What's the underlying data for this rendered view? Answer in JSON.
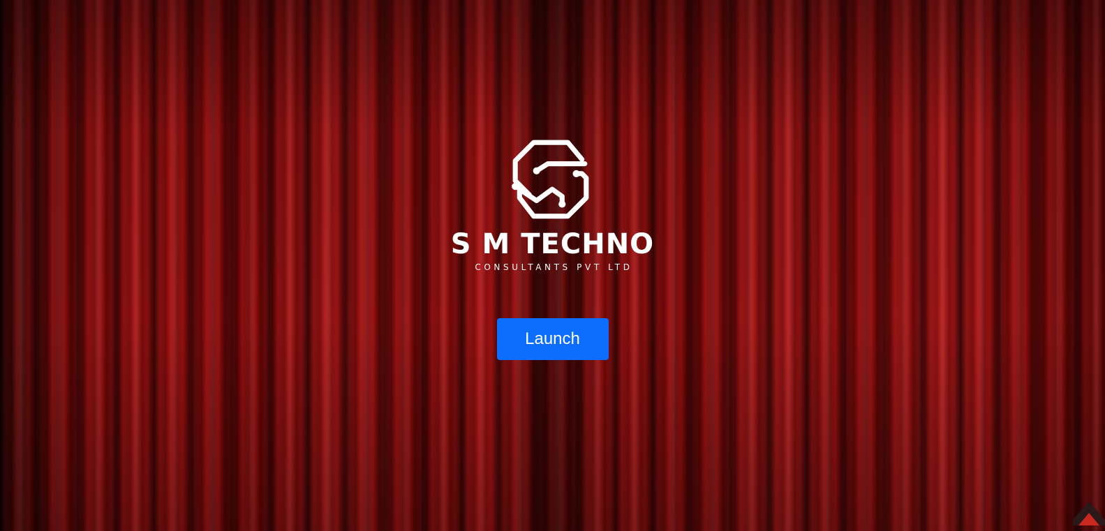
{
  "brand": {
    "name": "S M TECHNO",
    "tagline": "CONSULTANTS PVT LTD",
    "logo_icon": "sm-techno-logo-icon"
  },
  "actions": {
    "launch_label": "Launch"
  },
  "scroll_top": {
    "icon": "chevron-up-icon",
    "color_outer": "#2b1818",
    "color_inner": "#c8281e"
  },
  "colors": {
    "background": "#8b0a0a",
    "button": "#0d6efd",
    "text": "#ffffff"
  }
}
